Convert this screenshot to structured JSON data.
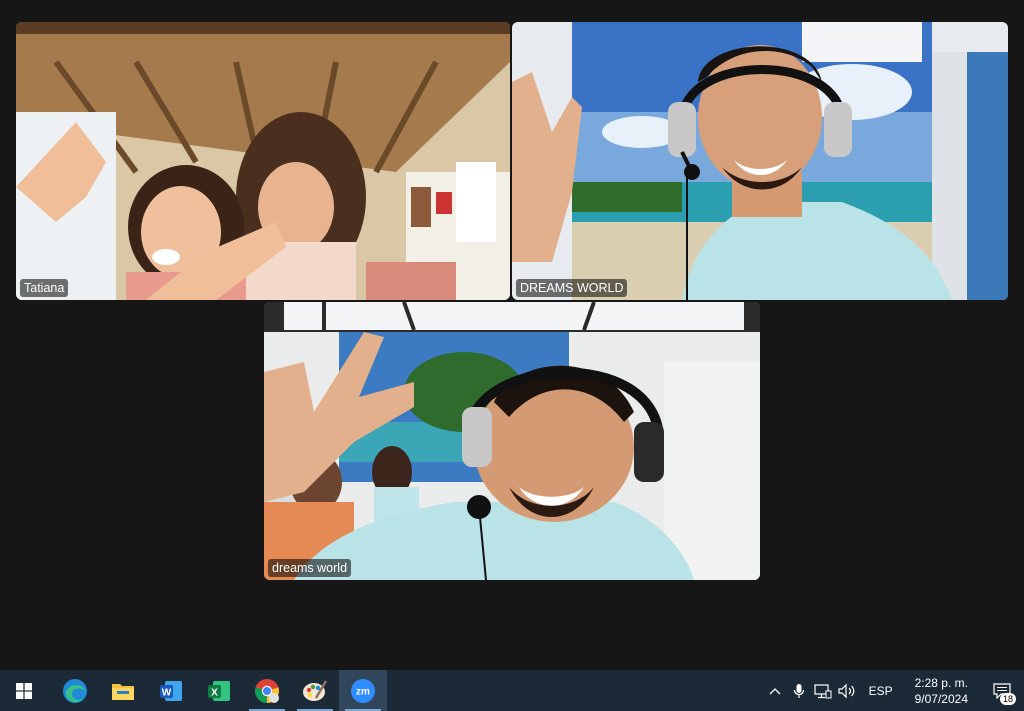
{
  "participants": [
    {
      "name": "Tatiana",
      "active": false
    },
    {
      "name": "DREAMS WORLD",
      "active": true
    },
    {
      "name": "dreams world",
      "active": false
    }
  ],
  "taskbar": {
    "apps": [
      {
        "icon": "edge-icon",
        "running": false
      },
      {
        "icon": "file-explorer-icon",
        "running": false
      },
      {
        "icon": "word-icon",
        "running": false
      },
      {
        "icon": "excel-icon",
        "running": false
      },
      {
        "icon": "chrome-icon",
        "running": true
      },
      {
        "icon": "paint-icon",
        "running": true
      },
      {
        "icon": "zoom-icon",
        "running": true
      }
    ],
    "word_letter": "W",
    "excel_letter": "X",
    "zoom_label": "zm",
    "language": "ESP",
    "time": "2:28 p. m.",
    "date": "9/07/2024",
    "notification_count": "18"
  },
  "colors": {
    "active_border": "#2ecc71",
    "taskbar_bg": "#1c2a38",
    "background": "#161616"
  }
}
